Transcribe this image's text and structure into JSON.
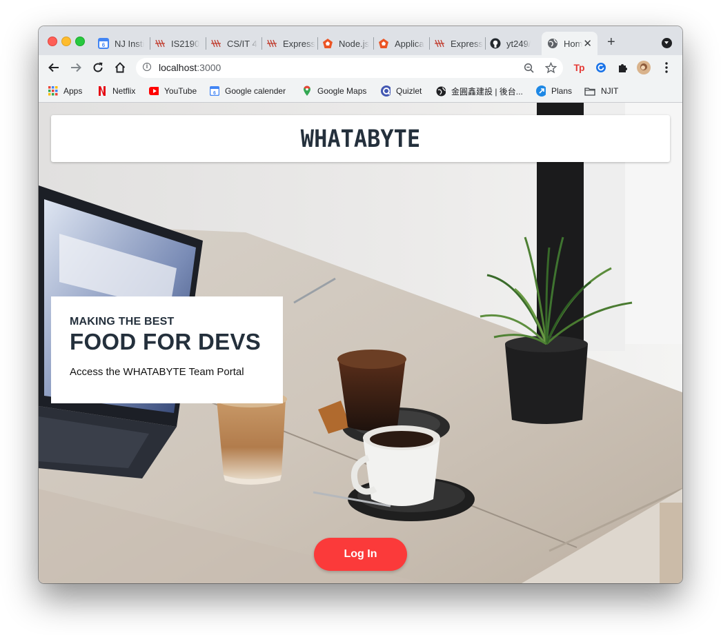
{
  "browser": {
    "tabs": [
      {
        "title": "NJ Insti",
        "icon": "google-calendar-icon"
      },
      {
        "title": "IS2190",
        "icon": "njit-icon"
      },
      {
        "title": "CS/IT 4",
        "icon": "njit-icon"
      },
      {
        "title": "Express",
        "icon": "njit-icon"
      },
      {
        "title": "Node.js",
        "icon": "auth0-icon"
      },
      {
        "title": "Applica",
        "icon": "auth0-icon"
      },
      {
        "title": "Express",
        "icon": "njit-icon"
      },
      {
        "title": "yt249/",
        "icon": "github-icon"
      },
      {
        "title": "Hom",
        "icon": "globe-icon",
        "active": true
      }
    ],
    "new_tab_label": "+",
    "address": {
      "host": "localhost",
      "port": ":3000"
    },
    "bookmarks": [
      {
        "label": "Apps",
        "icon": "apps-grid-icon"
      },
      {
        "label": "Netflix",
        "icon": "netflix-icon"
      },
      {
        "label": "YouTube",
        "icon": "youtube-icon"
      },
      {
        "label": "Google calender",
        "icon": "google-calendar-icon"
      },
      {
        "label": "Google Maps",
        "icon": "google-maps-icon"
      },
      {
        "label": "Quizlet",
        "icon": "quizlet-icon"
      },
      {
        "label": "金圓鑫建設 | 後台...",
        "icon": "globe-icon"
      },
      {
        "label": "Plans",
        "icon": "plans-icon"
      },
      {
        "label": "NJIT",
        "icon": "folder-icon"
      }
    ],
    "extensions": [
      "tp-extension-icon",
      "refresh-extension-icon",
      "puzzle-icon",
      "profile-avatar"
    ]
  },
  "page": {
    "brand": "WHATABYTE",
    "hero": {
      "subtitle": "MAKING THE BEST",
      "title": "FOOD FOR DEVS",
      "text": "Access the WHATABYTE Team Portal"
    },
    "login_label": "Log In"
  },
  "colors": {
    "brand_text": "#24303c",
    "login_button": "#fb3a3a",
    "tabstrip": "#dee1e6",
    "toolbar": "#f1f3f4"
  }
}
